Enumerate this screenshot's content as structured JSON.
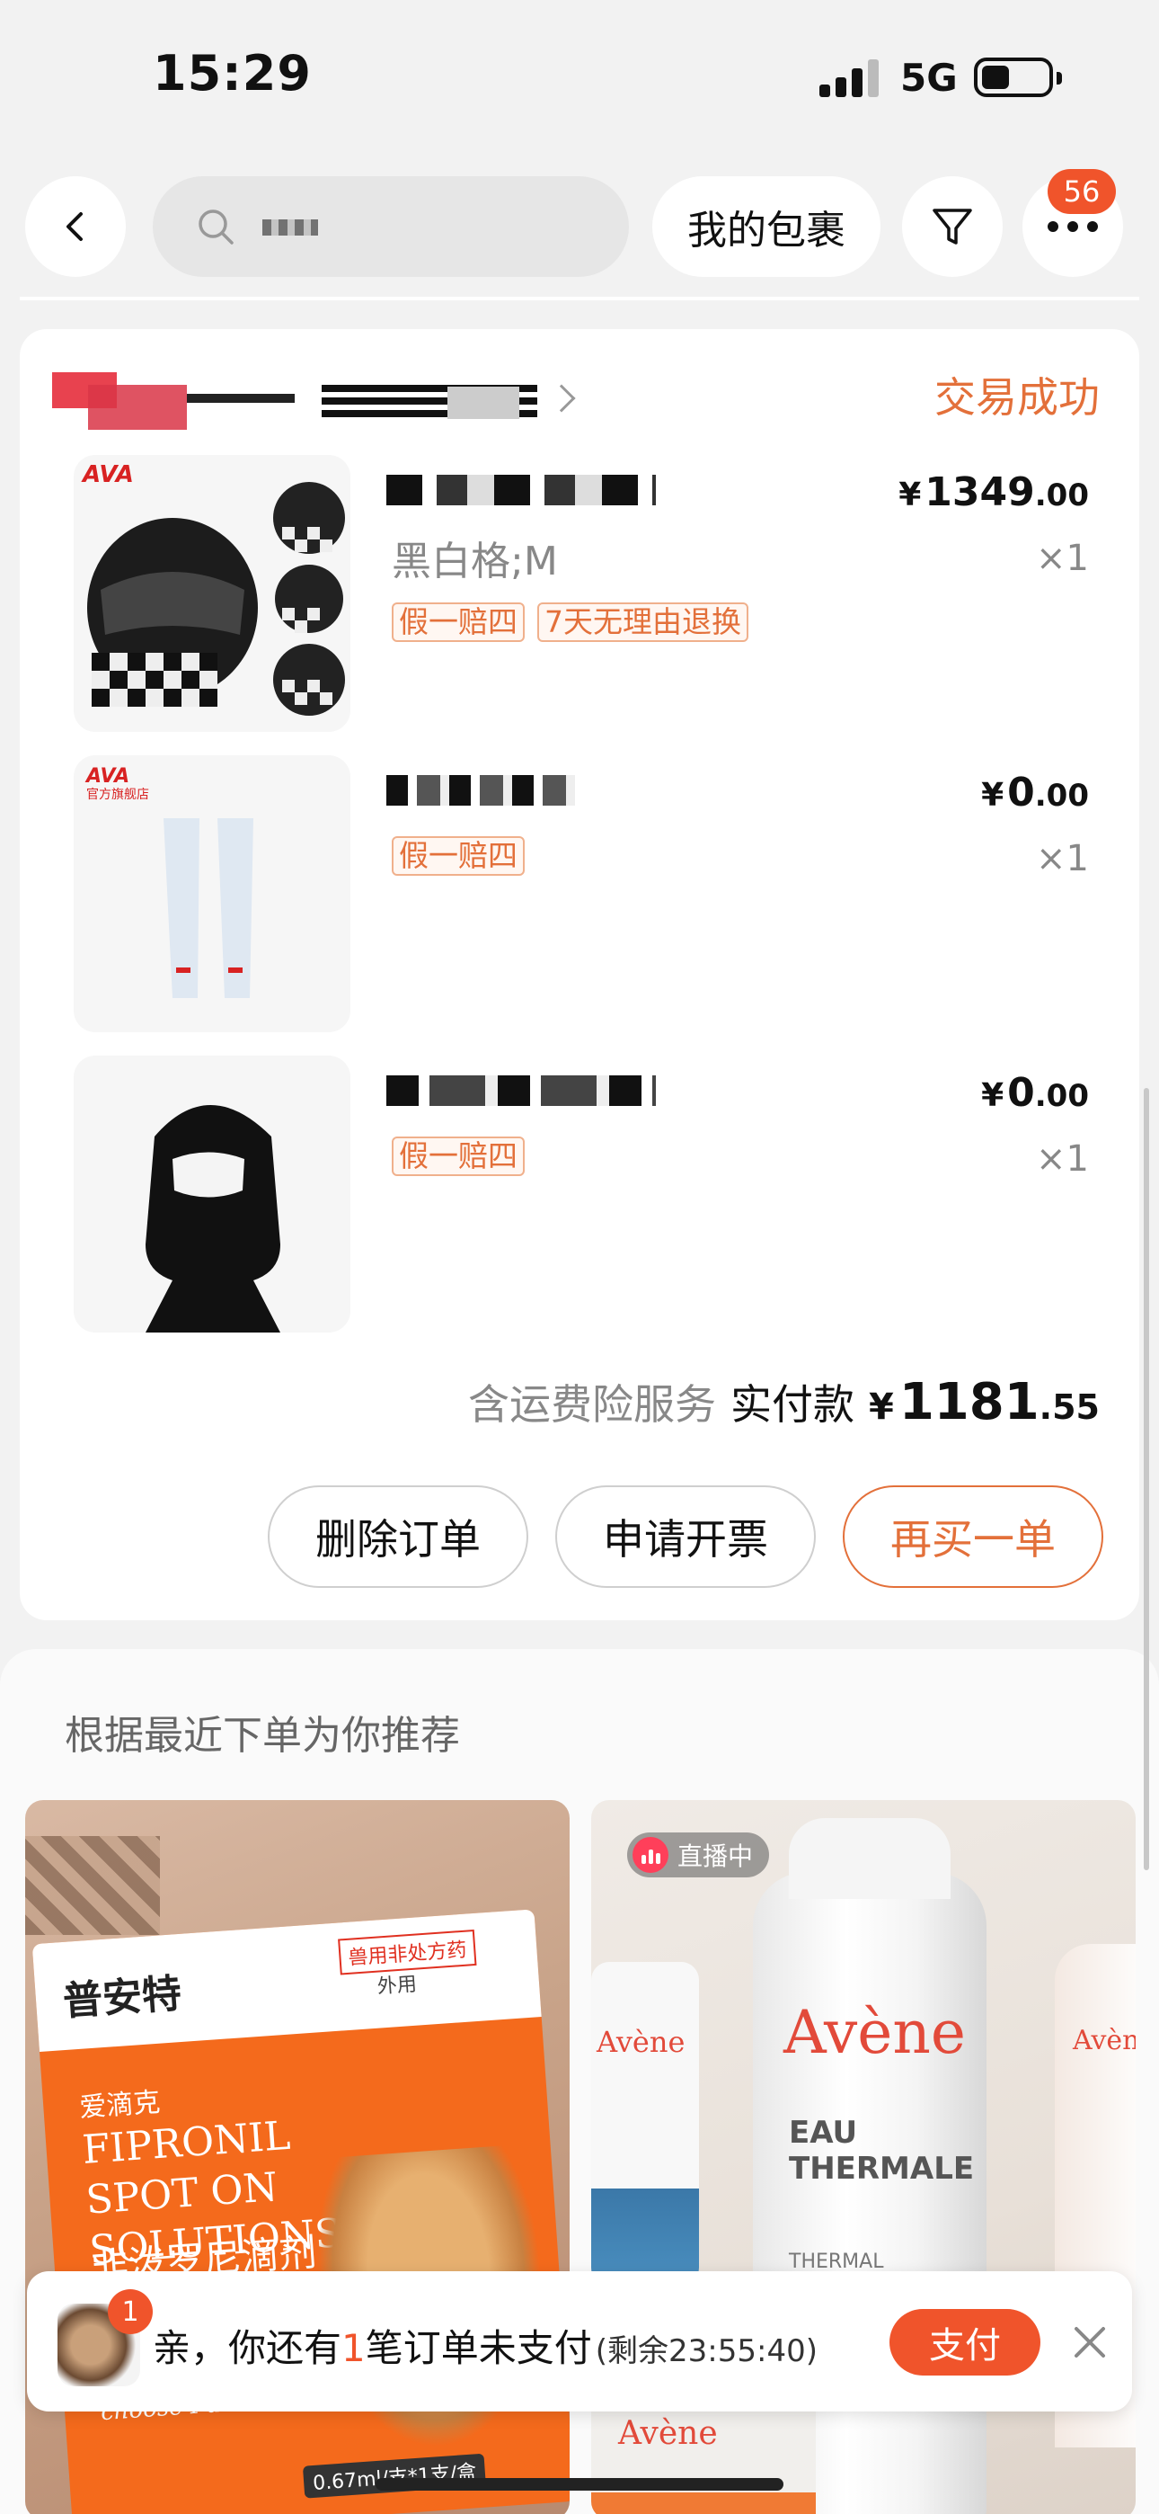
{
  "status_bar": {
    "time": "15:29",
    "network": "5G"
  },
  "nav": {
    "search_placeholder": "",
    "my_packages": "我的包裹",
    "more_badge": "56"
  },
  "order": {
    "status": "交易成功",
    "items": [
      {
        "spec": "黑白格;M",
        "tags": [
          "假一赔四",
          "7天无理由退换"
        ],
        "price_int": "1349",
        "price_dec": ".00",
        "qty": "×1"
      },
      {
        "spec": "",
        "tags": [
          "假一赔四"
        ],
        "price_int": "0",
        "price_dec": ".00",
        "qty": "×1"
      },
      {
        "spec": "",
        "tags": [
          "假一赔四"
        ],
        "price_int": "0",
        "price_dec": ".00",
        "qty": "×1"
      }
    ],
    "currency": "¥",
    "service_note": "含运费险服务",
    "paid_label": "实付款",
    "total_int": "1181",
    "total_dec": ".55",
    "actions": {
      "delete": "删除订单",
      "invoice": "申请开票",
      "rebuy": "再买一单"
    }
  },
  "recommend": {
    "title": "根据最近下单为你推荐",
    "left": {
      "brand": "普安特",
      "rx": "兽用非处方药",
      "rx2": "外用",
      "sub": "爱滴克",
      "en": "FIPRONIL SPOT ON SOLUTIONS",
      "cn": "非泼罗尼滴剂",
      "note": "The pet medicine choose Puainta",
      "size": "0.67ml/支*1支/盒"
    },
    "right": {
      "live_label": "直播中",
      "logo": "Avène",
      "line1": "EAU THERMALE",
      "line2": "THERMAL SPRING WATER",
      "side_logo": "Avène"
    }
  },
  "pay_banner": {
    "badge": "1",
    "msg_pre": "亲，你还有",
    "msg_count": "1",
    "msg_post": "笔订单未支付",
    "remain": "(剩余23:55:40)",
    "pay": "支付"
  },
  "colors": {
    "accent": "#e3703a",
    "badge": "#f0542b"
  }
}
